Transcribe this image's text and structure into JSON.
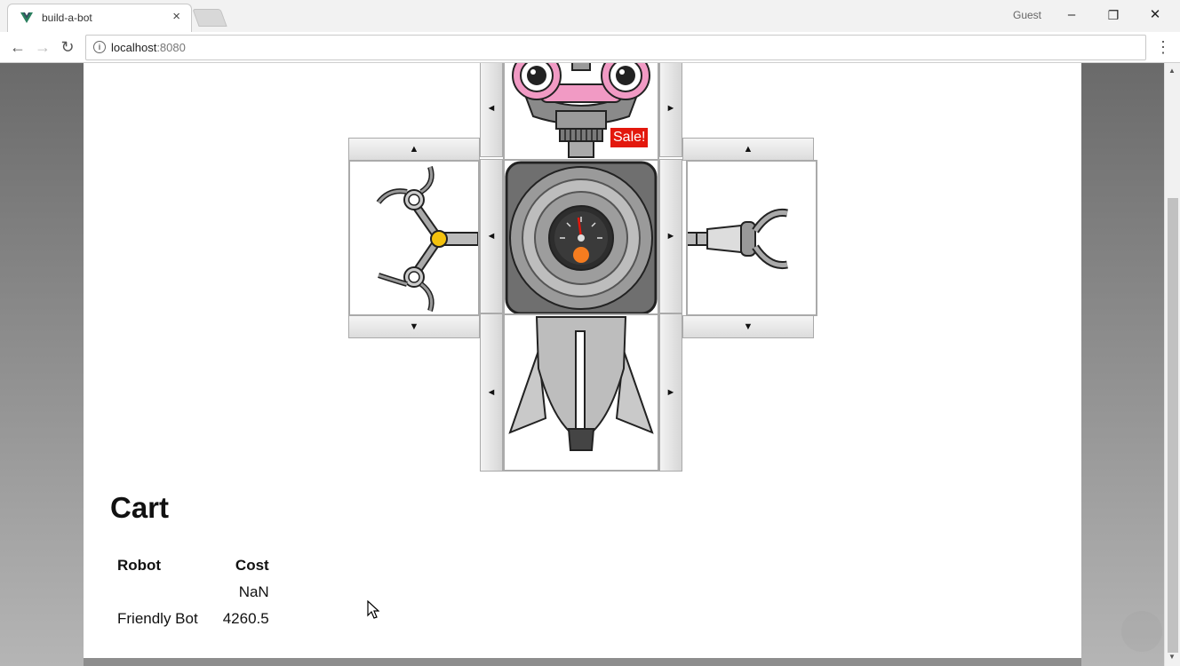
{
  "browser": {
    "tab_title": "build-a-bot",
    "profile_label": "Guest",
    "url_host": "localhost",
    "url_port": ":8080",
    "minimize_glyph": "–",
    "restore_glyph": "❐",
    "close_glyph": "✕",
    "tab_close_glyph": "×",
    "back_glyph": "←",
    "forward_glyph": "→",
    "reload_glyph": "↻",
    "menu_glyph": "⋮"
  },
  "builder": {
    "sale_label": "Sale!",
    "arrows": {
      "up": "▲",
      "down": "▼",
      "left": "◄",
      "right": "►"
    }
  },
  "cart": {
    "title": "Cart",
    "columns": [
      "Robot",
      "Cost"
    ],
    "rows": [
      {
        "robot": "",
        "cost": "NaN"
      },
      {
        "robot": "Friendly Bot",
        "cost": "4260.5"
      }
    ]
  },
  "colors": {
    "sale_badge": "#e3180d",
    "head_pink": "#f19ac4",
    "gauge_orange": "#f57c1f",
    "hand_yellow": "#f4c20d"
  }
}
